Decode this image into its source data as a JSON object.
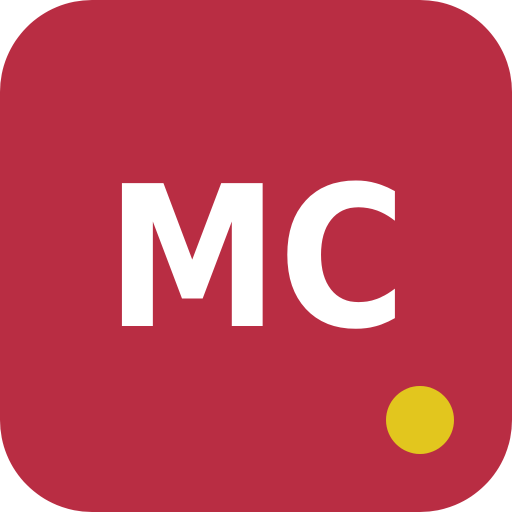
{
  "icon": {
    "monogram": "MC",
    "background_color": "#b92d43",
    "text_color": "#ffffff",
    "dot_color": "#e2c61e"
  }
}
